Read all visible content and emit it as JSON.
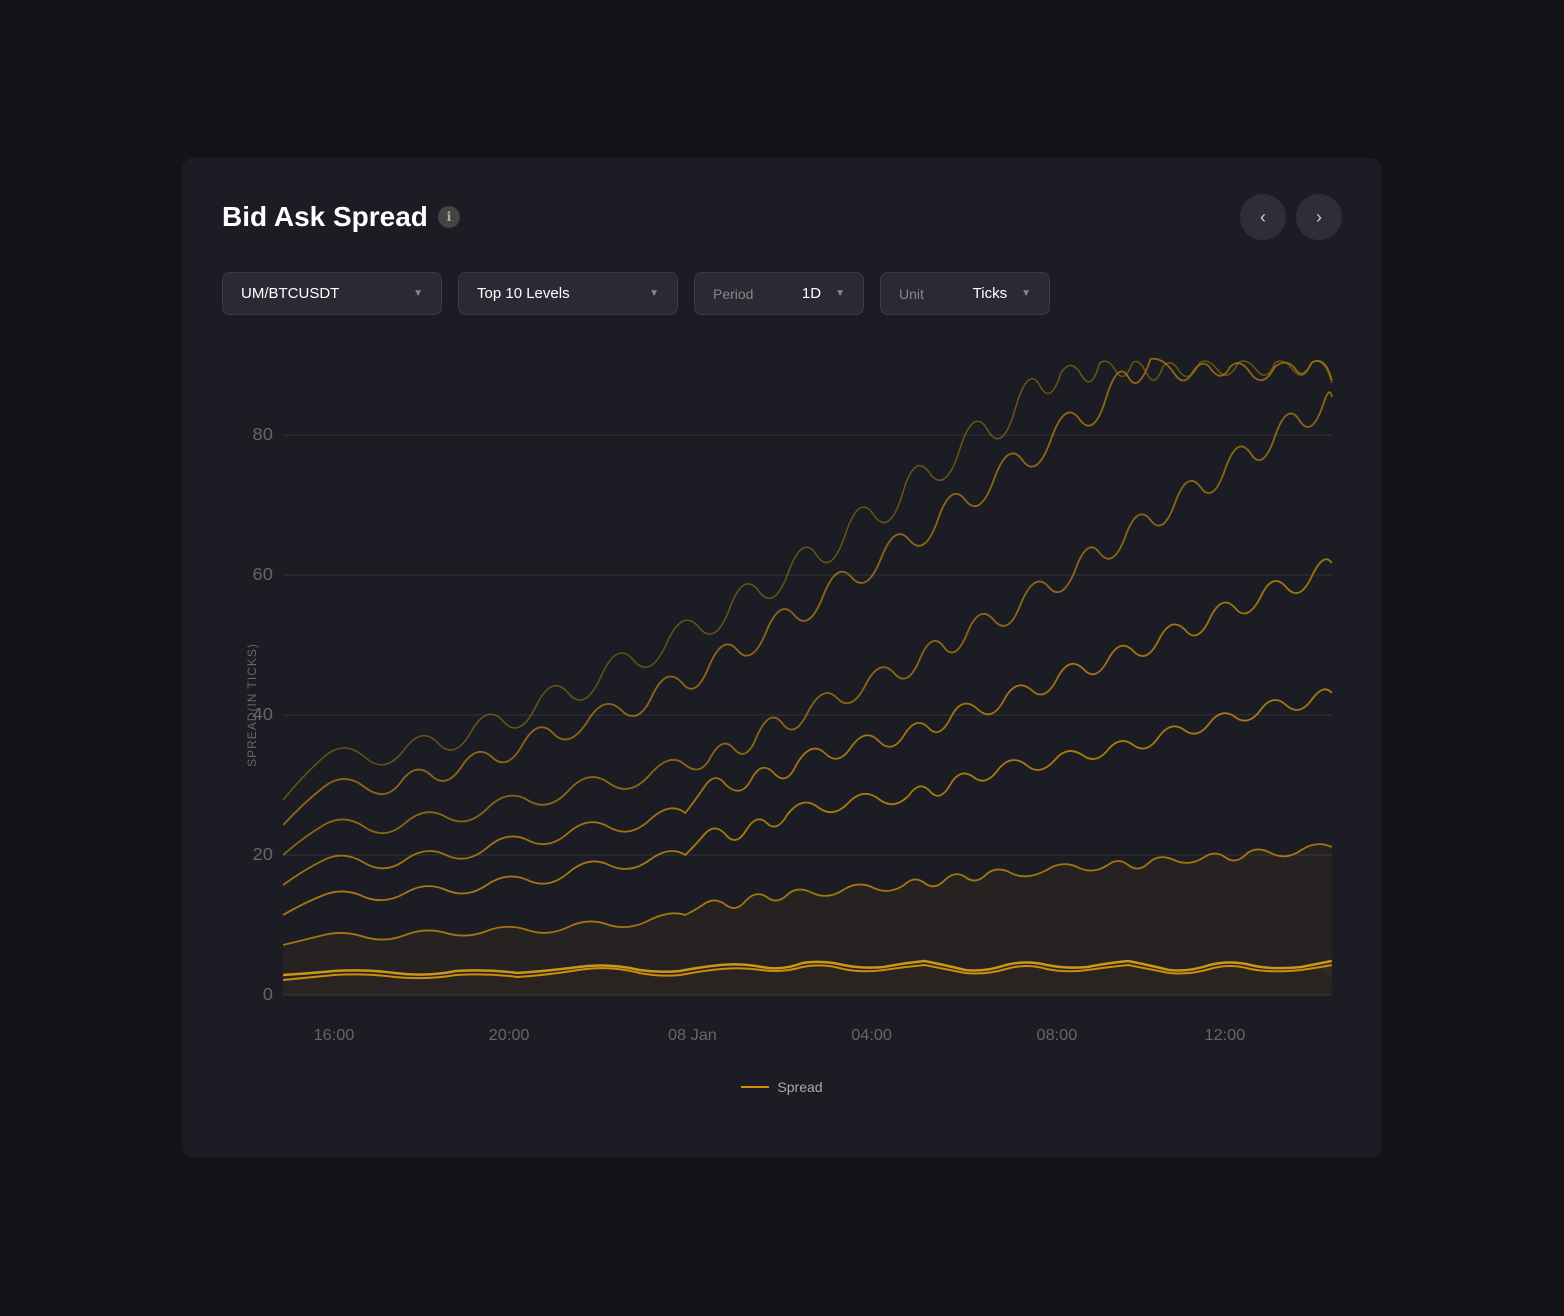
{
  "header": {
    "title": "Bid Ask Spread",
    "info_icon": "ℹ"
  },
  "nav": {
    "prev_label": "‹",
    "next_label": "›"
  },
  "controls": {
    "pair": {
      "value": "UM/BTCUSDT",
      "arrow": "▼"
    },
    "levels": {
      "value": "Top 10 Levels",
      "arrow": "▼"
    },
    "period": {
      "label": "Period",
      "value": "1D",
      "arrow": "▼"
    },
    "unit": {
      "label": "Unit",
      "value": "Ticks",
      "arrow": "▼"
    }
  },
  "chart": {
    "y_axis_label": "SPREAD(IN TICKS)",
    "y_ticks": [
      0,
      20,
      40,
      60,
      80
    ],
    "x_labels": [
      "16:00",
      "20:00",
      "08 Jan",
      "04:00",
      "08:00",
      "12:00"
    ]
  },
  "legend": {
    "label": "Spread"
  }
}
